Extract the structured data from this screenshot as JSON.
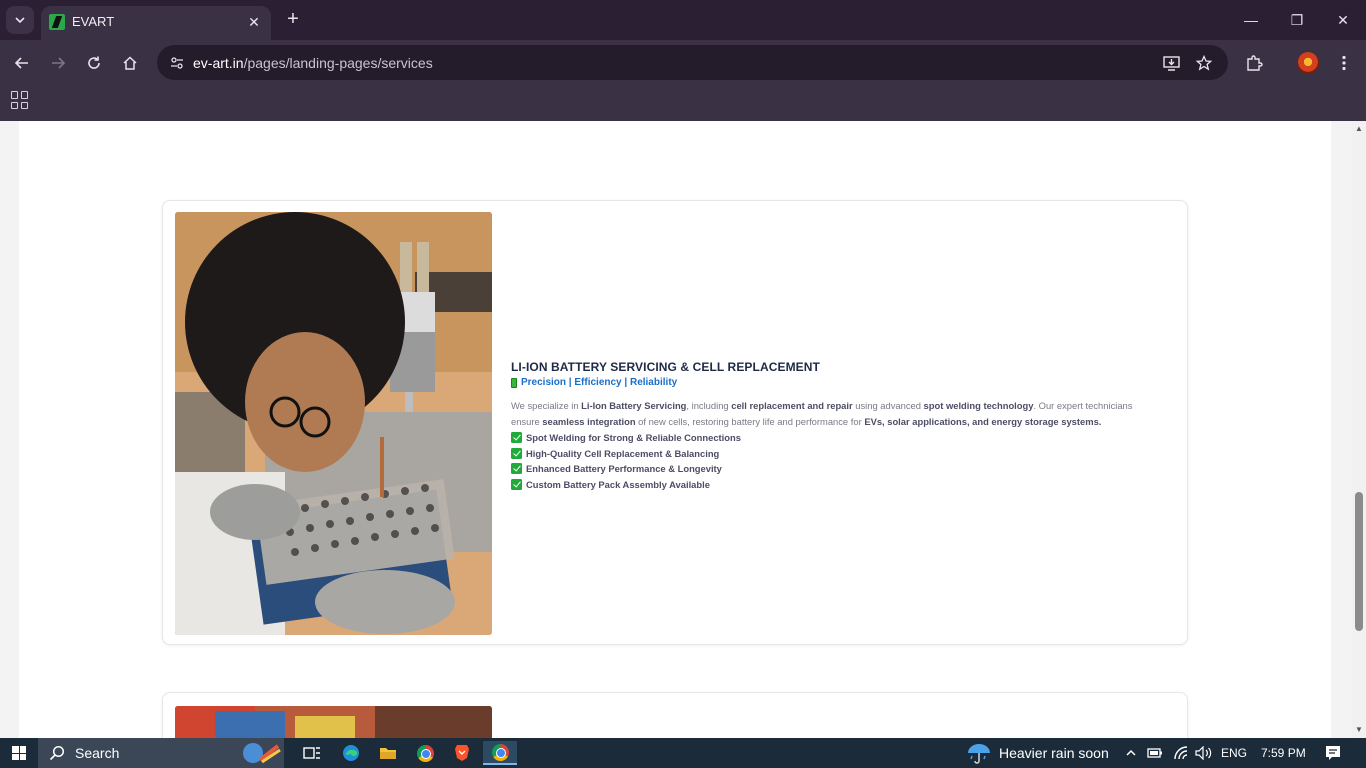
{
  "browser": {
    "tab_title": "EVART",
    "tab_close": "✕",
    "new_tab": "+",
    "url_domain": "ev-art.in",
    "url_path": "/pages/landing-pages/services",
    "window_controls": {
      "minimize": "—",
      "restore": "❐",
      "close": "✕"
    }
  },
  "service": {
    "title": "LI-ION BATTERY SERVICING & CELL REPLACEMENT",
    "subtitle": "Precision | Efficiency | Reliability",
    "description": {
      "p1": "We specialize in ",
      "b1": "Li-Ion Battery Servicing",
      "p2": ", including ",
      "b2": "cell replacement and repair",
      "p3": " using advanced ",
      "b3": "spot welding technology",
      "p4": ". Our expert technicians ensure ",
      "b4": "seamless integration",
      "p5": " of new cells, restoring battery life and performance for ",
      "b5": "EVs, solar applications, and energy storage systems."
    },
    "features": [
      "Spot Welding for Strong & Reliable Connections",
      "High-Quality Cell Replacement & Balancing",
      "Enhanced Battery Performance & Longevity",
      "Custom Battery Pack Assembly Available"
    ]
  },
  "taskbar": {
    "search_placeholder": "Search",
    "weather": "Heavier rain soon",
    "language": "ENG",
    "time": "7:59 PM"
  },
  "colors": {
    "title": "#1f2a44",
    "subtitle": "#1a6fc9",
    "check": "#1faa3a"
  }
}
